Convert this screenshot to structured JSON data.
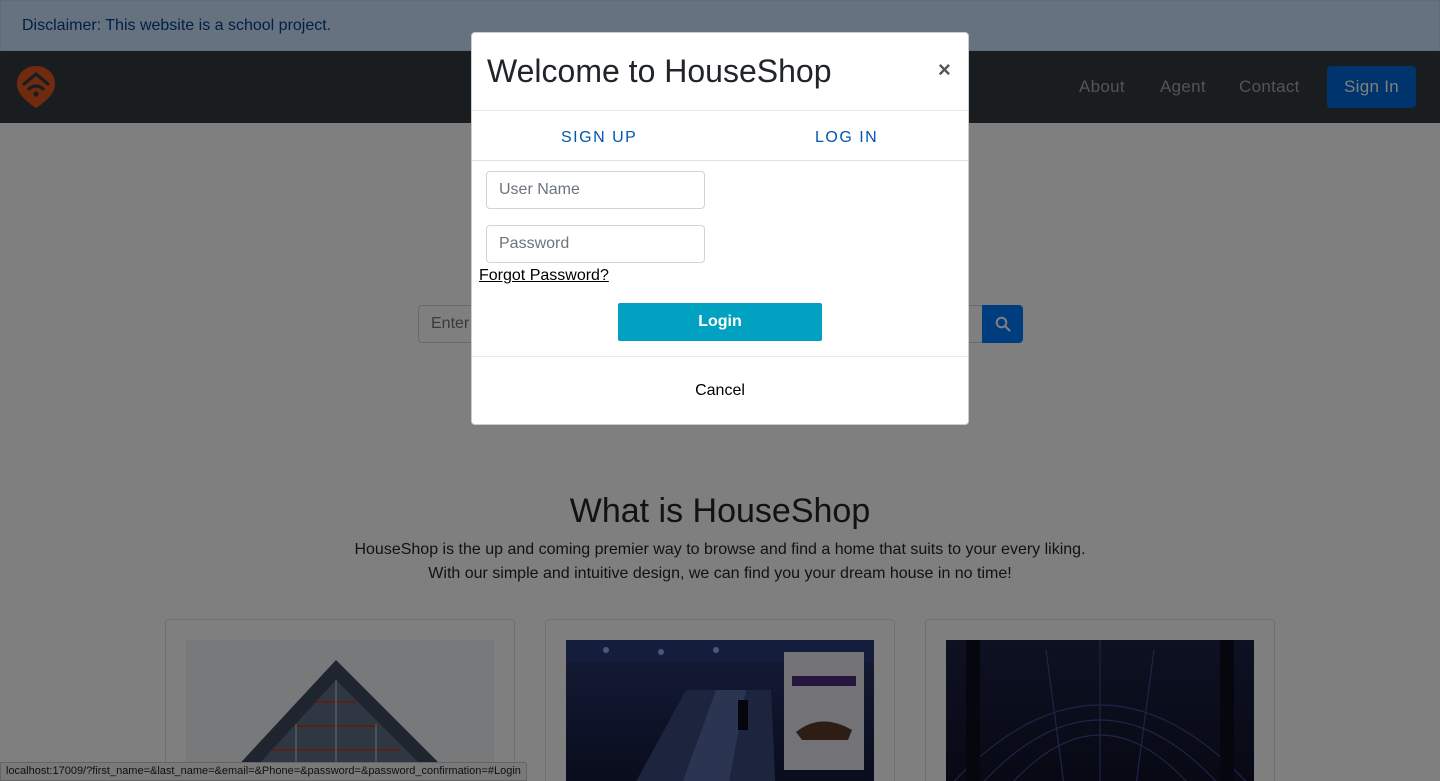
{
  "disclaimer": {
    "text": "Disclaimer: This website is a school project."
  },
  "navbar": {
    "logo_icon": "house-pin-logo-icon",
    "links": [
      "About",
      "Agent",
      "Contact"
    ],
    "signin_label": "Sign In"
  },
  "search": {
    "placeholder": "Enter",
    "button_icon": "search-icon"
  },
  "about": {
    "title": "What is HouseShop",
    "line1": "HouseShop is the up and coming premier way to browse and find a home that suits to your every liking.",
    "line2": "With our simple and intuitive design, we can find you your dream house in no time!"
  },
  "cards": [
    {
      "image": "modern-building-photo"
    },
    {
      "image": "escalator-mall-photo"
    },
    {
      "image": "glass-hall-photo"
    }
  ],
  "modal": {
    "title": "Welcome to HouseShop",
    "close_label": "×",
    "tabs": [
      "SIGN UP",
      "LOG IN"
    ],
    "username_placeholder": "User Name",
    "password_placeholder": "Password",
    "forgot_label": "Forgot Password?",
    "login_label": "Login",
    "cancel_label": "Cancel"
  },
  "status_bar": {
    "url": "localhost:17009/?first_name=&last_name=&email=&Phone=&password=&password_confirmation=#Login"
  },
  "colors": {
    "navbar": "#343a40",
    "primary": "#007bff",
    "login_button": "#00a1c1",
    "tab_text": "#0056b3",
    "disclaimer_bg": "#cce5ff"
  }
}
